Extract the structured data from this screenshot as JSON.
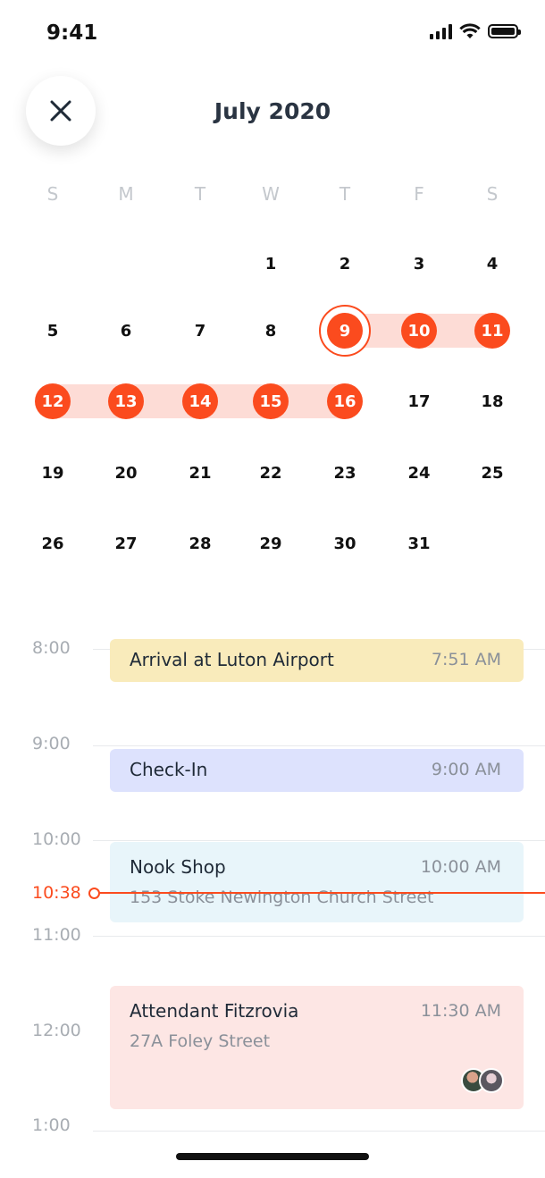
{
  "status": {
    "time": "9:41"
  },
  "header": {
    "title": "July 2020"
  },
  "weekdays": [
    "S",
    "M",
    "T",
    "W",
    "T",
    "F",
    "S"
  ],
  "calendar": {
    "rows": [
      [
        "",
        "",
        "",
        "1",
        "2",
        "3",
        "4"
      ],
      [
        "5",
        "6",
        "7",
        "8",
        "9",
        "10",
        "11"
      ],
      [
        "12",
        "13",
        "14",
        "15",
        "16",
        "17",
        "18"
      ],
      [
        "19",
        "20",
        "21",
        "22",
        "23",
        "24",
        "25"
      ],
      [
        "26",
        "27",
        "28",
        "29",
        "30",
        "31",
        ""
      ]
    ],
    "selected_range": [
      "9",
      "10",
      "11",
      "12",
      "13",
      "14",
      "15",
      "16"
    ],
    "range_start": "9",
    "accent_color": "#fb4b1e",
    "range_color": "#fddcd6"
  },
  "timeline": {
    "hours": [
      "8:00",
      "9:00",
      "10:00",
      "11:00",
      "12:00",
      "1:00"
    ],
    "now_label": "10:38",
    "events": [
      {
        "title": "Arrival at Luton Airport",
        "time": "7:51 AM",
        "color": "#f9ebbb"
      },
      {
        "title": "Check-In",
        "time": "9:00 AM",
        "color": "#dde2fd"
      },
      {
        "title": "Nook Shop",
        "time": "10:00 AM",
        "subtitle": "153 Stoke Newington Church Street",
        "color": "#e8f5fa"
      },
      {
        "title": "Attendant Fitzrovia",
        "time": "11:30 AM",
        "subtitle": "27A Foley Street",
        "color": "#fde6e4",
        "avatars": [
          "avatar-1",
          "avatar-2"
        ]
      }
    ]
  }
}
